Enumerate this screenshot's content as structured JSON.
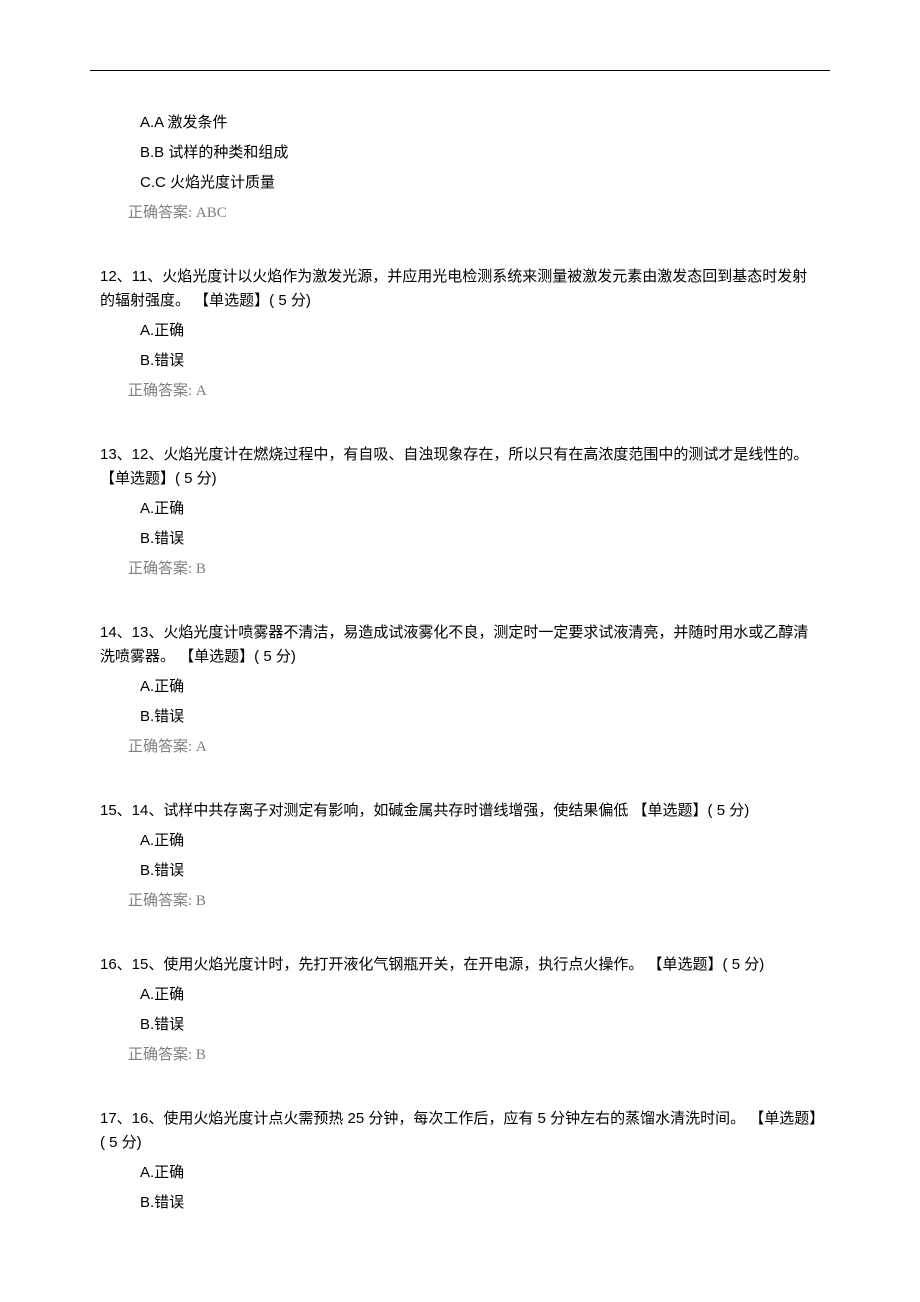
{
  "answer_prefix": "正确答案:",
  "q11": {
    "optA": "A.A 激发条件",
    "optB": "B.B 试样的种类和组成",
    "optC": "C.C 火焰光度计质量",
    "answer": "ABC"
  },
  "q12": {
    "text": "12、11、火焰光度计以火焰作为激发光源，并应用光电检测系统来测量被激发元素由激发态回到基态时发射的辐射强度。 【单选题】( 5 分)",
    "optA": "A.正确",
    "optB": "B.错误",
    "answer": "A"
  },
  "q13": {
    "text": "13、12、火焰光度计在燃烧过程中，有自吸、自浊现象存在，所以只有在高浓度范围中的测试才是线性的。【单选题】( 5 分)",
    "optA": "A.正确",
    "optB": "B.错误",
    "answer": "B"
  },
  "q14": {
    "text": "14、13、火焰光度计喷雾器不清洁，易造成试液雾化不良，测定时一定要求试液清亮，并随时用水或乙醇清洗喷雾器。 【单选题】( 5 分)",
    "optA": "A.正确",
    "optB": "B.错误",
    "answer": "A"
  },
  "q15": {
    "text": "15、14、试样中共存离子对测定有影响，如碱金属共存时谱线增强，使结果偏低  【单选题】( 5 分)",
    "optA": "A.正确",
    "optB": "B.错误",
    "answer": "B"
  },
  "q16": {
    "text": "16、15、使用火焰光度计时，先打开液化气钢瓶开关，在开电源，执行点火操作。 【单选题】( 5 分)",
    "optA": "A.正确",
    "optB": "B.错误",
    "answer": "B"
  },
  "q17": {
    "text": "17、16、使用火焰光度计点火需预热 25 分钟，每次工作后，应有 5 分钟左右的蒸馏水清洗时间。 【单选题】( 5 分)",
    "optA": "A.正确",
    "optB": "B.错误"
  }
}
